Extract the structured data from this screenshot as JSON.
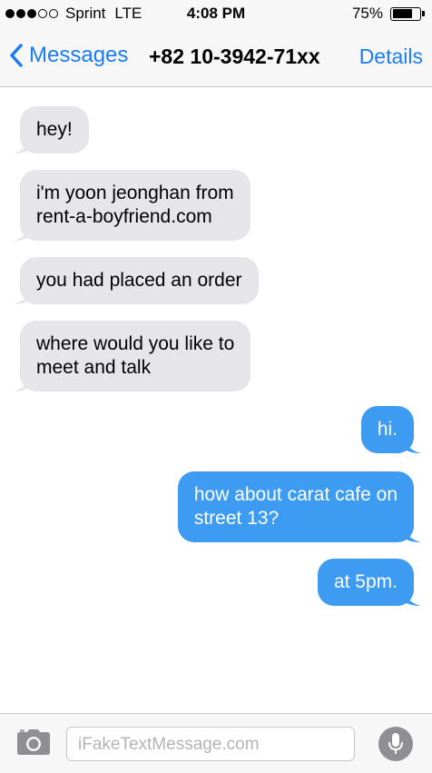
{
  "status_bar": {
    "signal_bars_filled": 3,
    "signal_bars_total": 5,
    "carrier": "Sprint",
    "network": "LTE",
    "time": "4:08 PM",
    "battery_text": "75%",
    "battery_level": 0.75
  },
  "nav": {
    "back_label": "Messages",
    "title": "+82 10-3942-71xx",
    "details_label": "Details"
  },
  "messages": [
    {
      "direction": "incoming",
      "text": "hey!"
    },
    {
      "direction": "incoming",
      "text": "i'm yoon jeonghan from\nrent-a-boyfriend.com"
    },
    {
      "direction": "incoming",
      "text": "you had placed an order"
    },
    {
      "direction": "incoming",
      "text": "where would you like to\nmeet and talk"
    },
    {
      "direction": "outgoing",
      "text": "hi."
    },
    {
      "direction": "outgoing",
      "text": "how about carat cafe on\nstreet 13?"
    },
    {
      "direction": "outgoing",
      "text": "at 5pm."
    }
  ],
  "input_bar": {
    "placeholder": "iFakeTextMessage.com",
    "camera_icon": "camera-icon",
    "mic_icon": "microphone-icon"
  },
  "colors": {
    "accent": "#1a7cf5",
    "incoming_bubble": "#e5e5ea",
    "outgoing_bubble": "#3d9cf2"
  }
}
